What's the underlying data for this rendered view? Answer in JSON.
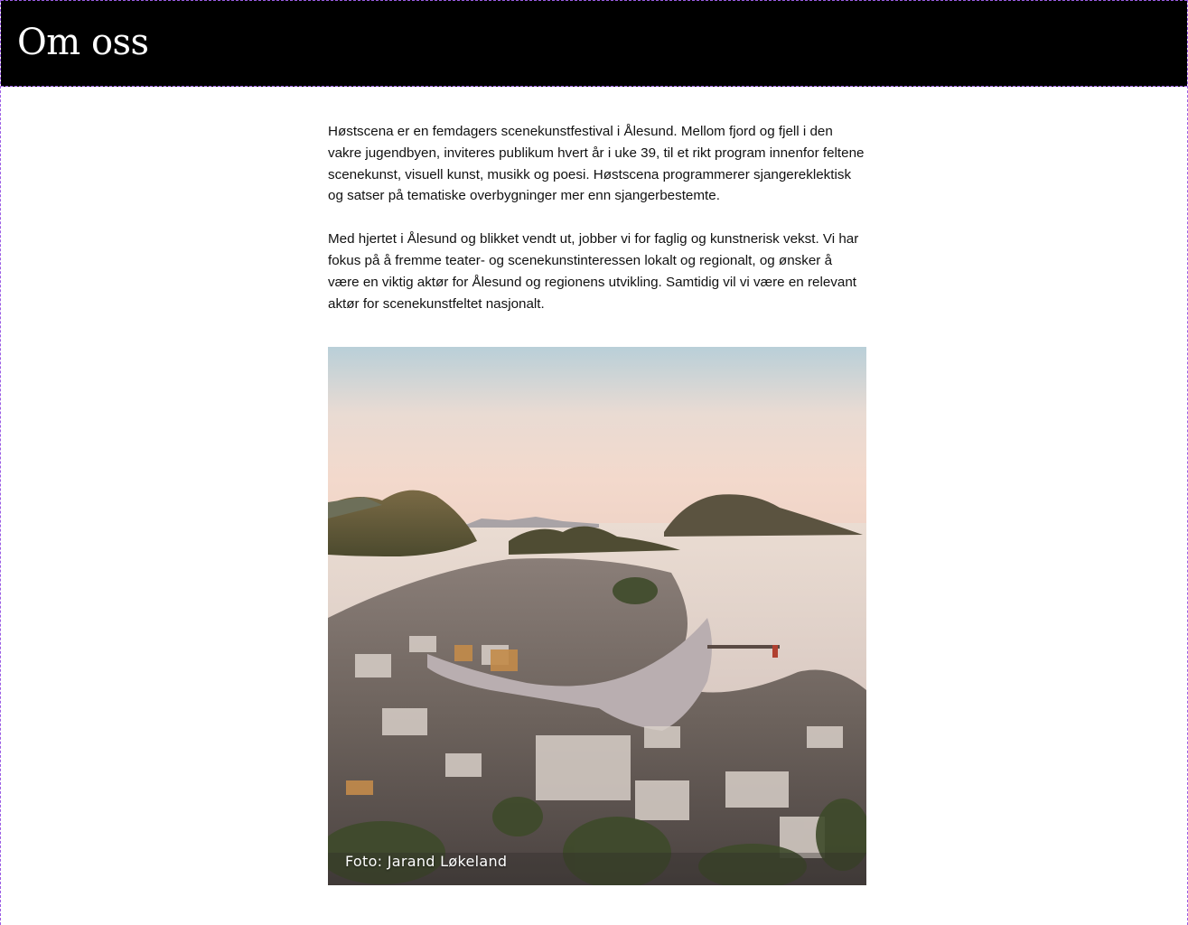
{
  "header": {
    "title": "Om oss"
  },
  "main": {
    "paragraphs": [
      "Høstscena er en femdagers scenekunstfestival i Ålesund. Mellom fjord og fjell i den vakre jugendbyen, inviteres publikum hvert år i uke 39, til et rikt program innenfor feltene scenekunst, visuell kunst, musikk og poesi. Høstscena programmerer sjangereklektisk og satser på tematiske overbygninger mer enn sjangerbestemte.",
      "Med hjertet i Ålesund og blikket vendt ut, jobber vi for faglig og kunstnerisk vekst. Vi har fokus på å fremme teater- og scenekunstinteressen lokalt og regionalt, og ønsker å være en viktig aktør for Ålesund og regionens utvikling. Samtidig vil vi være en relevant aktør for scenekunstfeltet nasjonalt."
    ],
    "photo": {
      "credit": "Foto: Jarand Løkeland"
    }
  },
  "colors": {
    "header_background": "#000000",
    "header_text": "#ffffff",
    "page_background": "#ffffff",
    "body_text": "#111111"
  }
}
